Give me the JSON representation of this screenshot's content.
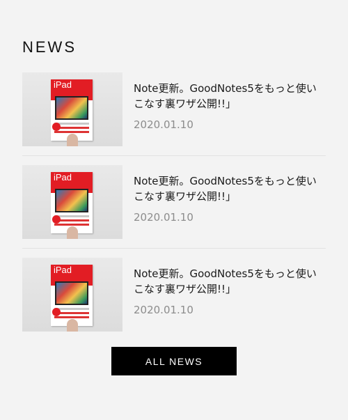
{
  "section": {
    "title": "NEWS"
  },
  "news": [
    {
      "title": "Note更新。GoodNotes5をもっと使いこなす裏ワザ公開!!」",
      "date": "2020.01.10",
      "thumbnail_brand": "iPad"
    },
    {
      "title": "Note更新。GoodNotes5をもっと使いこなす裏ワザ公開!!」",
      "date": "2020.01.10",
      "thumbnail_brand": "iPad"
    },
    {
      "title": "Note更新。GoodNotes5をもっと使いこなす裏ワザ公開!!」",
      "date": "2020.01.10",
      "thumbnail_brand": "iPad"
    }
  ],
  "button": {
    "label": "ALL NEWS"
  },
  "colors": {
    "background": "#f3f3f3",
    "button_background": "#000000",
    "button_text": "#ffffff",
    "date_text": "#8c8c8c",
    "book_accent": "#e21d24"
  }
}
